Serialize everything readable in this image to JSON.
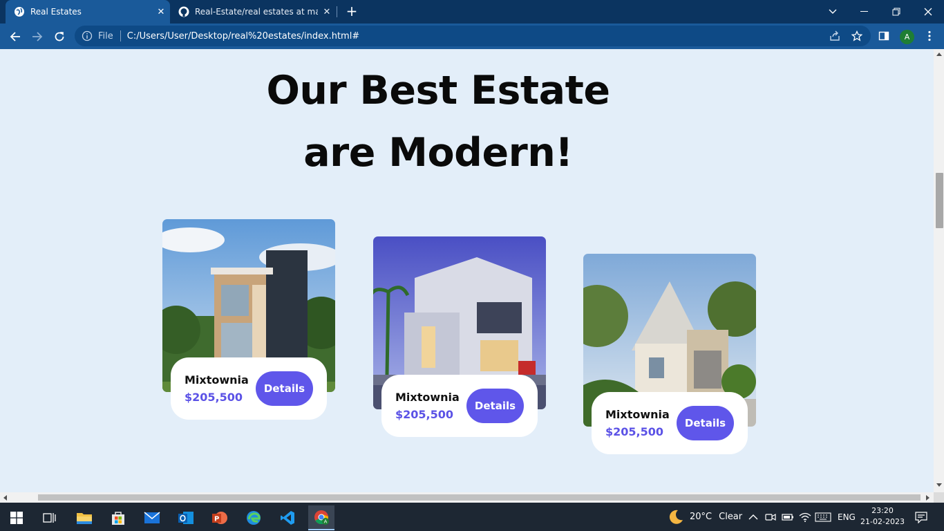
{
  "browser": {
    "tabs": [
      {
        "title": "Real Estates",
        "active": true,
        "icon": "globe-icon"
      },
      {
        "title": "Real-Estate/real estates at main ·",
        "active": false,
        "icon": "github-icon"
      }
    ],
    "omnibox": {
      "scheme_label": "File",
      "url": "C:/Users/User/Desktop/real%20estates/index.html#"
    },
    "profile_initial": "A"
  },
  "page": {
    "heading_line1": "Our Best Estate",
    "heading_line2": "are Modern!",
    "cards": [
      {
        "name": "Mixtownia",
        "price": "$205,500",
        "button": "Details"
      },
      {
        "name": "Mixtownia",
        "price": "$205,500",
        "button": "Details"
      },
      {
        "name": "Mixtownia",
        "price": "$205,500",
        "button": "Details"
      }
    ],
    "colors": {
      "accent": "#5f56ea",
      "price": "#5b52e6",
      "background": "#e3eef9"
    }
  },
  "taskbar": {
    "weather": {
      "temp": "20°C",
      "condition": "Clear"
    },
    "language": "ENG",
    "time": "23:20",
    "date": "21-02-2023",
    "apps": [
      "start-icon",
      "task-view-icon",
      "file-explorer-icon",
      "store-icon",
      "mail-icon",
      "outlook-icon",
      "powerpoint-icon",
      "edge-icon",
      "vscode-icon",
      "chrome-icon"
    ]
  }
}
